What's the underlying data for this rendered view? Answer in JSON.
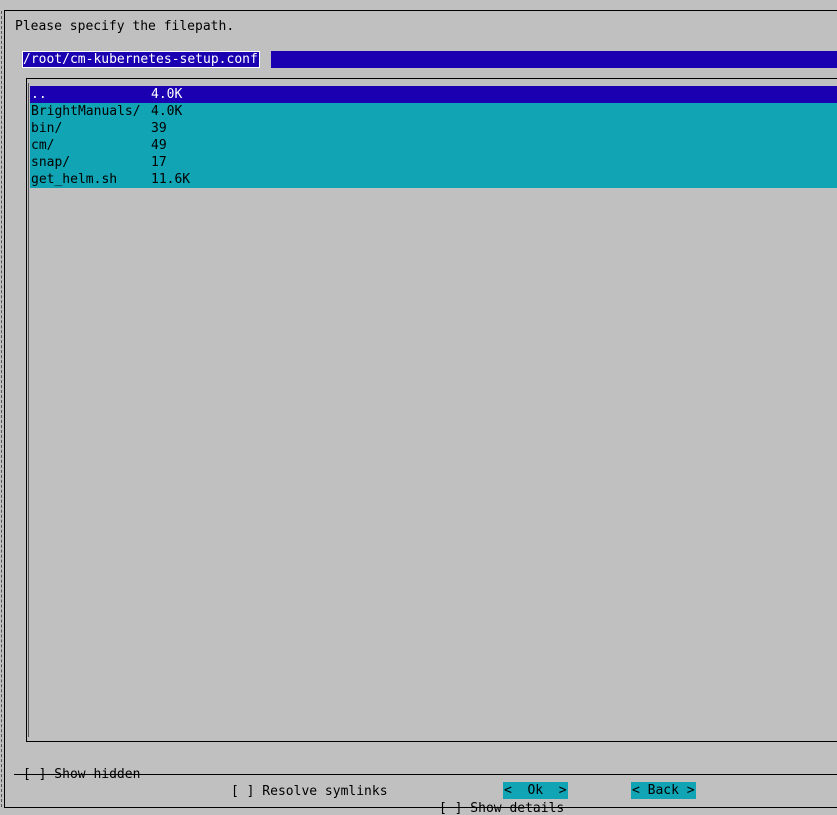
{
  "dialog": {
    "prompt": "Please specify the filepath."
  },
  "path_input": {
    "value": "/root/cm-kubernetes-setup.conf"
  },
  "file_list": [
    {
      "name": "..",
      "size": "4.0K",
      "selected": true
    },
    {
      "name": "BrightManuals/",
      "size": "4.0K",
      "selected": false
    },
    {
      "name": "bin/",
      "size": "39",
      "selected": false
    },
    {
      "name": "cm/",
      "size": "49",
      "selected": false
    },
    {
      "name": "snap/",
      "size": "17",
      "selected": false
    },
    {
      "name": "get_helm.sh",
      "size": "11.6K",
      "selected": false
    }
  ],
  "options": {
    "show_hidden": "[ ] Show hidden",
    "resolve_symlinks": "[ ] Resolve symlinks",
    "show_details": "[ ] Show details"
  },
  "buttons": {
    "ok": "<  Ok  >",
    "back": "< Back >"
  },
  "colors": {
    "background": "#c0c0c0",
    "selection": "#1a00b0",
    "list_item": "#10a4b4",
    "button": "#10a4b4"
  }
}
